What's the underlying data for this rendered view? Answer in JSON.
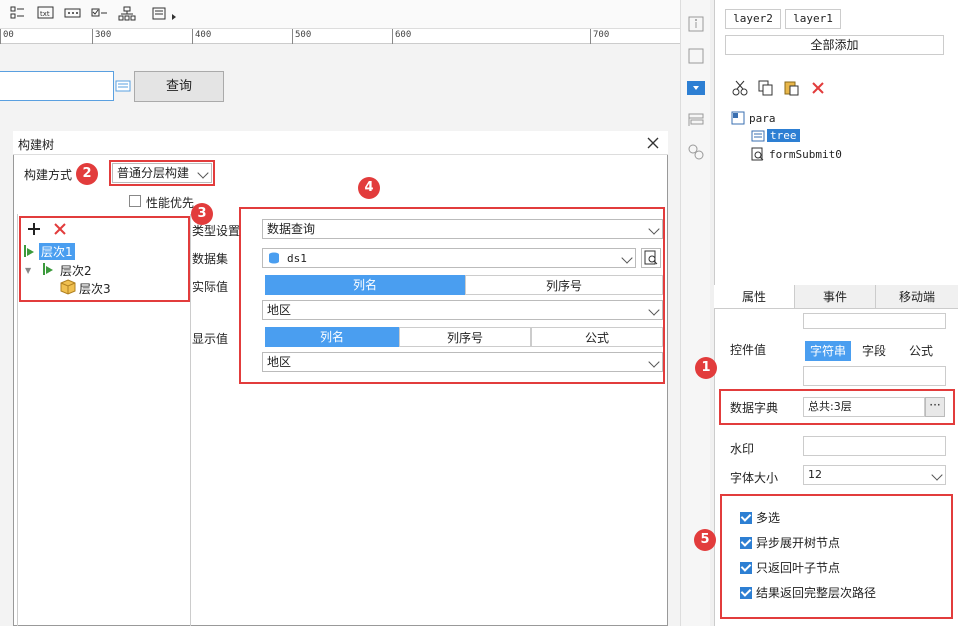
{
  "toolbar": {
    "icons": [
      "list-icon",
      "text-icon",
      "password-icon",
      "checkbox-icon",
      "tree-icon",
      "more-icon"
    ]
  },
  "ruler": {
    "ticks": [
      "00",
      "300",
      "400",
      "500",
      "600",
      "700"
    ]
  },
  "canvas": {
    "query_label": "查询"
  },
  "right_panel": {
    "layer_buttons": [
      "layer2",
      "layer1"
    ],
    "add_all_label": "全部添加",
    "tree": {
      "root": "para",
      "child_selected": "tree",
      "child2": "formSubmit0"
    },
    "tabs": [
      "属性",
      "事件",
      "移动端"
    ],
    "props": {
      "control_value_label": "控件值",
      "control_value_options": [
        "字符串",
        "字段",
        "公式"
      ],
      "data_dict_label": "数据字典",
      "data_dict_value": "总共:3层",
      "watermark_label": "水印",
      "font_size_label": "字体大小",
      "font_size_value": "12"
    },
    "checkboxes": [
      "多选",
      "异步展开树节点",
      "只返回叶子节点",
      "结果返回完整层次路径"
    ]
  },
  "dialog": {
    "title": "构建树",
    "build_method_label": "构建方式",
    "build_method_value": "普通分层构建",
    "performance_label": "性能优先",
    "levels": [
      "层次1",
      "层次2",
      "层次3"
    ],
    "type_label": "类型设置",
    "type_value": "数据查询",
    "dataset_label": "数据集",
    "dataset_value": "ds1",
    "actual_label": "实际值",
    "actual_options": [
      "列名",
      "列序号"
    ],
    "actual_value": "地区",
    "display_label": "显示值",
    "display_options": [
      "列名",
      "列序号",
      "公式"
    ],
    "display_value": "地区"
  },
  "badges": [
    "1",
    "2",
    "3",
    "4",
    "5"
  ],
  "colors": {
    "accent": "#4a9ef0",
    "highlight": "#e23c3c",
    "selected": "#2d7fd3"
  }
}
